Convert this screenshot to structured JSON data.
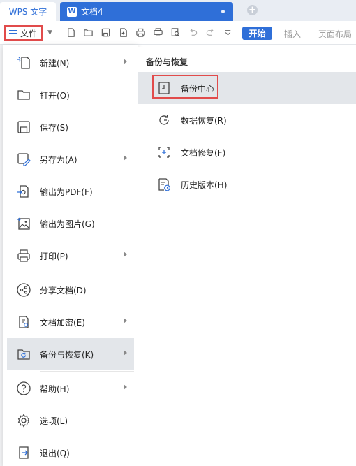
{
  "titlebar": {
    "app_tab_label": "WPS 文字",
    "doc_tab_label": "文档4",
    "doc_icon_letter": "W"
  },
  "toolbar": {
    "file_label": "文件",
    "icons": [
      "new-file-icon",
      "open-folder-icon",
      "save-icon",
      "export-pdf-icon",
      "print-icon",
      "print-preview-icon",
      "find-icon",
      "undo-icon",
      "redo-icon",
      "customize-icon"
    ],
    "ribbon_tabs": [
      "开始",
      "插入",
      "页面布局"
    ]
  },
  "menu": {
    "items": [
      {
        "label": "新建(N)",
        "icon": "new-icon",
        "has_submenu": true
      },
      {
        "label": "打开(O)",
        "icon": "open-icon",
        "has_submenu": false
      },
      {
        "label": "保存(S)",
        "icon": "save-icon",
        "has_submenu": false
      },
      {
        "label": "另存为(A)",
        "icon": "save-as-icon",
        "has_submenu": true
      },
      {
        "label": "输出为PDF(F)",
        "icon": "export-pdf-icon",
        "has_submenu": false
      },
      {
        "label": "输出为图片(G)",
        "icon": "export-image-icon",
        "has_submenu": false
      },
      {
        "label": "打印(P)",
        "icon": "print-icon",
        "has_submenu": true
      },
      {
        "label": "分享文档(D)",
        "icon": "share-icon",
        "has_submenu": false
      },
      {
        "label": "文档加密(E)",
        "icon": "encrypt-icon",
        "has_submenu": true
      },
      {
        "label": "备份与恢复(K)",
        "icon": "backup-restore-icon",
        "has_submenu": true,
        "active": true
      },
      {
        "label": "帮助(H)",
        "icon": "help-icon",
        "has_submenu": true
      },
      {
        "label": "选项(L)",
        "icon": "options-gear-icon",
        "has_submenu": false
      },
      {
        "label": "退出(Q)",
        "icon": "exit-icon",
        "has_submenu": false
      }
    ]
  },
  "submenu": {
    "title": "备份与恢复",
    "items": [
      {
        "label": "备份中心",
        "icon": "backup-center-icon",
        "highlighted": true
      },
      {
        "label": "数据恢复(R)",
        "icon": "data-recovery-icon"
      },
      {
        "label": "文档修复(F)",
        "icon": "document-repair-icon"
      },
      {
        "label": "历史版本(H)",
        "icon": "history-version-icon"
      }
    ]
  },
  "colors": {
    "accent": "#2f6fd8",
    "highlight_border": "#e14b4b",
    "active_row": "#e3e6ea"
  }
}
